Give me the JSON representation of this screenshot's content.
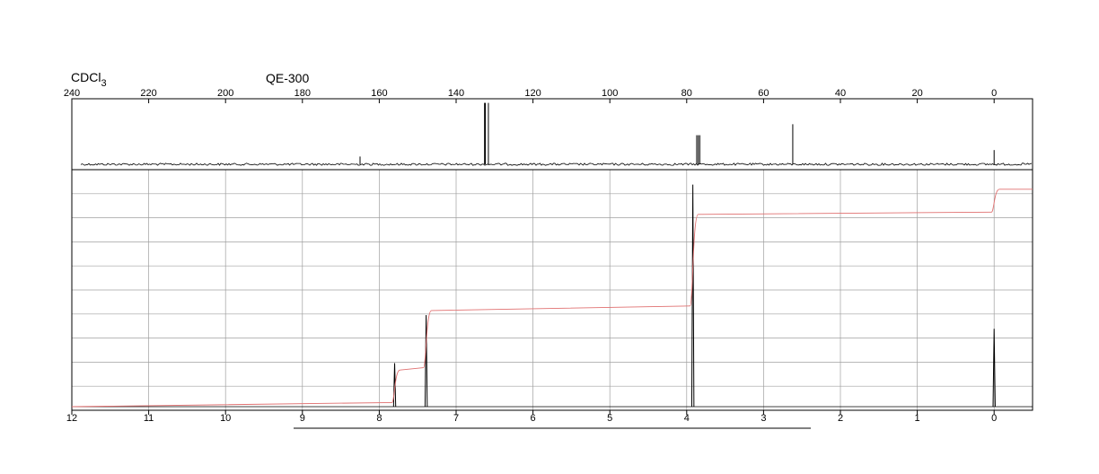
{
  "header": {
    "solvent": "CDCl",
    "solvent_subscript": "3",
    "instrument": "QE-300"
  },
  "chart_data": [
    {
      "type": "line",
      "panel": "13C NMR",
      "x_direction": "decreasing",
      "xlim": [
        240,
        -10
      ],
      "x_ticks": [
        240,
        220,
        200,
        180,
        160,
        140,
        120,
        100,
        80,
        60,
        40,
        20,
        0
      ],
      "x_tick_labels": [
        "240",
        "220",
        "200",
        "180",
        "160",
        "140",
        "120",
        "100",
        "80",
        "60",
        "40",
        "20",
        "0"
      ],
      "peaks": [
        {
          "x": 165.0,
          "height": 0.12
        },
        {
          "x": 132.6,
          "height": 0.95
        },
        {
          "x": 132.4,
          "height": 0.95
        },
        {
          "x": 131.6,
          "height": 0.95
        },
        {
          "x": 77.4,
          "height": 0.45
        },
        {
          "x": 77.0,
          "height": 0.45
        },
        {
          "x": 76.6,
          "height": 0.45
        },
        {
          "x": 52.4,
          "height": 0.62
        },
        {
          "x": 0.0,
          "height": 0.22
        }
      ]
    },
    {
      "type": "line",
      "panel": "1H NMR",
      "x_direction": "decreasing",
      "xlim": [
        12,
        -0.5
      ],
      "x_ticks": [
        12,
        11,
        10,
        9,
        8,
        7,
        6,
        5,
        4,
        3,
        2,
        1,
        0
      ],
      "x_tick_labels": [
        "12",
        "11",
        "10",
        "9",
        "8",
        "7",
        "6",
        "5",
        "4",
        "3",
        "2",
        "1",
        "0"
      ],
      "grid": true,
      "peaks": [
        {
          "x": 7.8,
          "height": 0.19
        },
        {
          "x": 7.39,
          "height": 0.4
        },
        {
          "x": 3.92,
          "height": 0.97
        },
        {
          "x": 0.0,
          "height": 0.34
        }
      ],
      "integral_steps": [
        {
          "x": 7.8,
          "level_before": 0.018,
          "level_after": 0.16
        },
        {
          "x": 7.39,
          "level_before": 0.17,
          "level_after": 0.42
        },
        {
          "x": 3.92,
          "level_before": 0.44,
          "level_after": 0.84
        },
        {
          "x": 0.0,
          "level_before": 0.85,
          "level_after": 0.95
        }
      ]
    }
  ]
}
